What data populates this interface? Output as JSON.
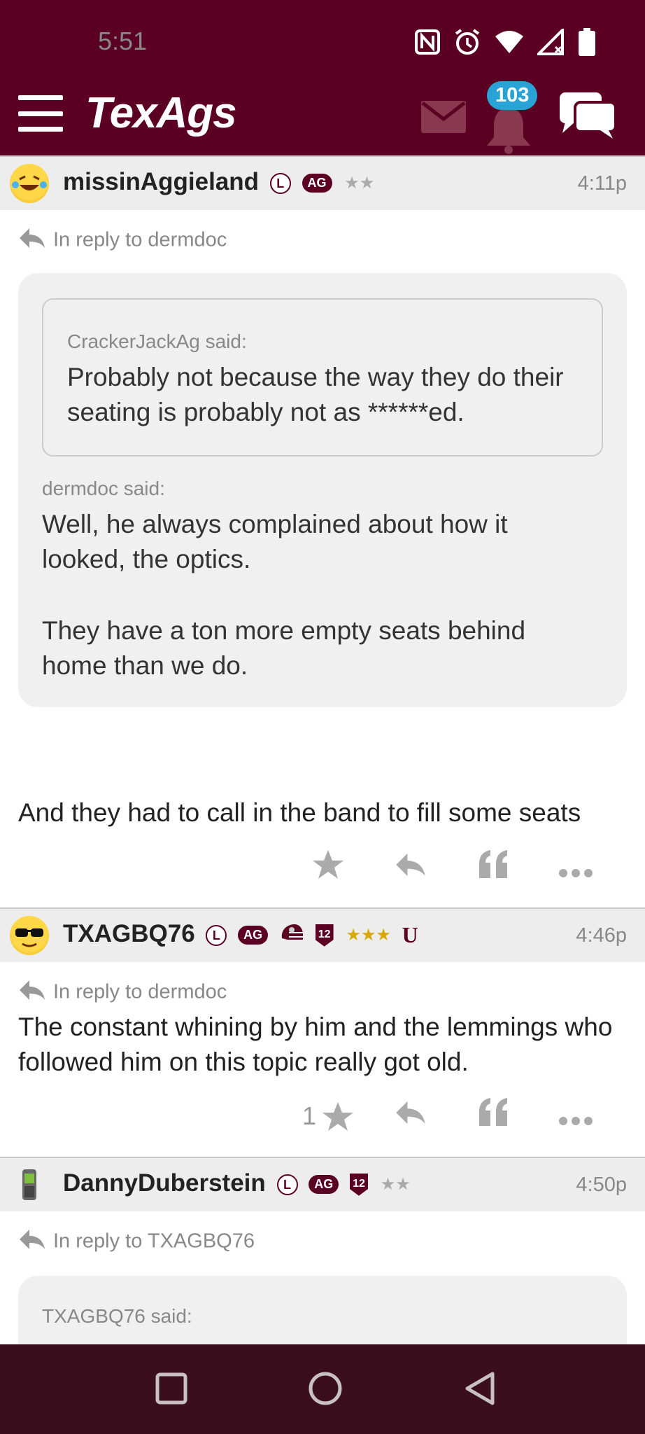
{
  "status_bar": {
    "time": "5:51"
  },
  "header": {
    "logo": "TexAgs",
    "notification_count": "103"
  },
  "posts": [
    {
      "username": "missinAggieland",
      "badges": [
        "L",
        "AG"
      ],
      "stars": "★★",
      "time": "4:11p",
      "reply_to": "In reply to dermdoc",
      "nested_quote": {
        "author": "CrackerJackAg said:",
        "text": "Probably not because the way they do their seating is probably not as ******ed."
      },
      "quote": {
        "author": "dermdoc said:",
        "paragraphs": [
          "Well, he always complained about how it looked, the optics.",
          "They have a ton more empty seats behind home than we do."
        ]
      },
      "body": "And they had to call in the band to fill some seats",
      "star_count": ""
    },
    {
      "username": "TXAGBQ76",
      "badges": [
        "L",
        "AG",
        "12"
      ],
      "stars": "★★★",
      "extra_badge": "U",
      "time": "4:46p",
      "reply_to": "In reply to dermdoc",
      "body": "The constant whining by him and the lemmings who followed him on this topic really got old.",
      "star_count": "1"
    },
    {
      "username": "DannyDuberstein",
      "badges": [
        "L",
        "AG",
        "12"
      ],
      "stars": "★★",
      "time": "4:50p",
      "reply_to": "In reply to TXAGBQ76",
      "quote": {
        "author": "TXAGBQ76 said:"
      }
    }
  ],
  "colors": {
    "maroon": "#5b0022",
    "badge_blue": "#29a3d6",
    "navbar": "#3a0e1d"
  }
}
